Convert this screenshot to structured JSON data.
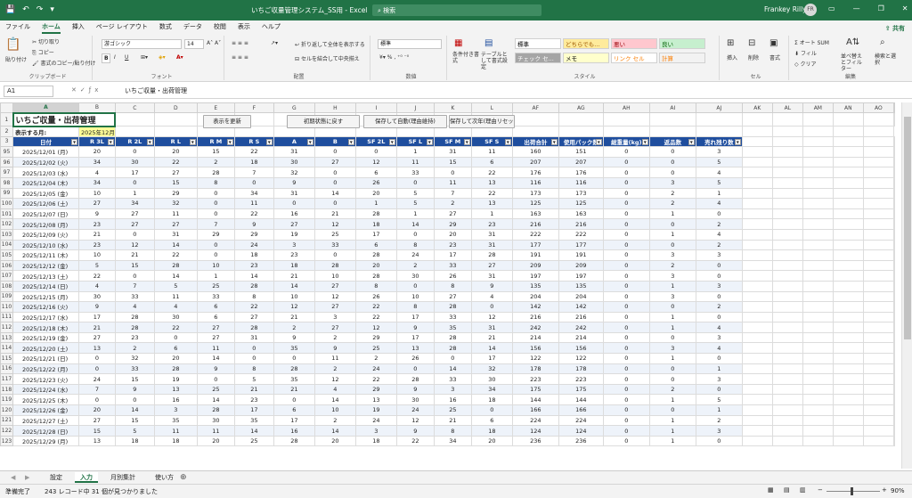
{
  "window": {
    "title": "いちご収量管理システム_SS用 - Excel",
    "search": "検索",
    "user": "Frankey Rilly",
    "avatar": "FR",
    "qat": [
      "💾",
      "↶",
      "↷",
      "▾"
    ],
    "controls": [
      "▭",
      "—",
      "❐",
      "✕"
    ]
  },
  "tabs": [
    {
      "label": "ファイル"
    },
    {
      "label": "ホーム",
      "active": true
    },
    {
      "label": "挿入"
    },
    {
      "label": "ページ レイアウト"
    },
    {
      "label": "数式"
    },
    {
      "label": "データ"
    },
    {
      "label": "校閲"
    },
    {
      "label": "表示"
    },
    {
      "label": "ヘルプ"
    }
  ],
  "share_label": "共有",
  "ribbon": {
    "clipboard": {
      "label": "クリップボード",
      "paste": "貼り付け",
      "cut": "切り取り",
      "copy": "コピー",
      "format_painter": "書式のコピー/貼り付け"
    },
    "font": {
      "label": "フォント",
      "name": "游ゴシック",
      "size": "14",
      "bold": "B",
      "italic": "I",
      "underline": "U"
    },
    "alignment": {
      "label": "配置",
      "wrap": "折り返して全体を表示する",
      "merge": "セルを結合して中央揃え"
    },
    "number": {
      "label": "数値",
      "format": "標準"
    },
    "styles": {
      "label": "スタイル",
      "conditional": "条件付き書式",
      "table": "テーブルとして書式設定",
      "cells": [
        {
          "text": "標準",
          "bg": "#ffffff",
          "color": "#000000"
        },
        {
          "text": "どちらでも...",
          "bg": "#ffeb9c",
          "color": "#9c5700"
        },
        {
          "text": "悪い",
          "bg": "#ffc7ce",
          "color": "#9c0006"
        },
        {
          "text": "良い",
          "bg": "#c6efce",
          "color": "#006100"
        },
        {
          "text": "チェック セ...",
          "bg": "#a5a5a5",
          "color": "#ffffff"
        },
        {
          "text": "メモ",
          "bg": "#ffffcc",
          "color": "#000000"
        },
        {
          "text": "リンク セル",
          "bg": "#ffffff",
          "color": "#fa7d00"
        },
        {
          "text": "計算",
          "bg": "#f2f2f2",
          "color": "#fa7d00"
        }
      ]
    },
    "cells_group": {
      "label": "セル",
      "insert": "挿入",
      "delete": "削除",
      "format": "書式"
    },
    "editing": {
      "label": "編集",
      "autosum": "オート SUM",
      "fill": "フィル",
      "clear": "クリア",
      "sort": "並べ替えとフィルター",
      "find": "検索と選択"
    }
  },
  "formula_bar": {
    "name_box": "A1",
    "content": "いちご収量・出荷管理"
  },
  "sheet": {
    "columns": [
      "A",
      "B",
      "C",
      "D",
      "E",
      "F",
      "G",
      "H",
      "I",
      "J",
      "K",
      "L",
      "AF",
      "AG",
      "AH",
      "AI",
      "AJ",
      "AK",
      "AL",
      "AM",
      "AN",
      "AO"
    ],
    "title": "いちご収量・出荷管理",
    "display_month_label": "表示する月:",
    "display_month_value": "2025年12月",
    "buttons": [
      "表示を更新",
      "初期状態に戻す",
      "保存して自動(理由維持)",
      "保存して次年(理由リセット)"
    ],
    "headers": [
      "日付",
      "R 3L",
      "R 2L",
      "R L",
      "R M",
      "R S",
      "A",
      "B",
      "SF 2L",
      "SF L",
      "SF M",
      "SF S",
      "出荷合計",
      "使用パック数",
      "総重量(kg)",
      "返品数",
      "売れ残り数"
    ],
    "rows": [
      [
        "95",
        "2025/12/01 (月)",
        "20",
        "0",
        "20",
        "15",
        "22",
        "31",
        "0",
        "0",
        "1",
        "31",
        "11",
        "160",
        "151",
        "0",
        "0",
        "3"
      ],
      [
        "96",
        "2025/12/02 (火)",
        "34",
        "30",
        "22",
        "2",
        "18",
        "30",
        "27",
        "12",
        "11",
        "15",
        "6",
        "207",
        "207",
        "0",
        "0",
        "5"
      ],
      [
        "97",
        "2025/12/03 (水)",
        "4",
        "17",
        "27",
        "28",
        "7",
        "32",
        "0",
        "6",
        "33",
        "0",
        "22",
        "176",
        "176",
        "0",
        "0",
        "4"
      ],
      [
        "98",
        "2025/12/04 (木)",
        "34",
        "0",
        "15",
        "8",
        "0",
        "9",
        "0",
        "26",
        "0",
        "11",
        "13",
        "116",
        "116",
        "0",
        "3",
        "5"
      ],
      [
        "99",
        "2025/12/05 (金)",
        "10",
        "1",
        "29",
        "0",
        "34",
        "31",
        "14",
        "20",
        "5",
        "7",
        "22",
        "173",
        "173",
        "0",
        "2",
        "1"
      ],
      [
        "100",
        "2025/12/06 (土)",
        "27",
        "34",
        "32",
        "0",
        "11",
        "0",
        "0",
        "1",
        "5",
        "2",
        "13",
        "125",
        "125",
        "0",
        "2",
        "4"
      ],
      [
        "101",
        "2025/12/07 (日)",
        "9",
        "27",
        "11",
        "0",
        "22",
        "16",
        "21",
        "28",
        "1",
        "27",
        "1",
        "163",
        "163",
        "0",
        "1",
        "0"
      ],
      [
        "102",
        "2025/12/08 (月)",
        "23",
        "27",
        "27",
        "7",
        "9",
        "27",
        "12",
        "18",
        "14",
        "29",
        "23",
        "216",
        "216",
        "0",
        "0",
        "2"
      ],
      [
        "103",
        "2025/12/09 (火)",
        "21",
        "0",
        "31",
        "29",
        "29",
        "19",
        "25",
        "17",
        "0",
        "20",
        "31",
        "222",
        "222",
        "0",
        "1",
        "4"
      ],
      [
        "104",
        "2025/12/10 (水)",
        "23",
        "12",
        "14",
        "0",
        "24",
        "3",
        "33",
        "6",
        "8",
        "23",
        "31",
        "177",
        "177",
        "0",
        "0",
        "2"
      ],
      [
        "105",
        "2025/12/11 (木)",
        "10",
        "21",
        "22",
        "0",
        "18",
        "23",
        "0",
        "28",
        "24",
        "17",
        "28",
        "191",
        "191",
        "0",
        "3",
        "3"
      ],
      [
        "106",
        "2025/12/12 (金)",
        "5",
        "15",
        "28",
        "10",
        "23",
        "18",
        "28",
        "20",
        "2",
        "33",
        "27",
        "209",
        "209",
        "0",
        "2",
        "0"
      ],
      [
        "107",
        "2025/12/13 (土)",
        "22",
        "0",
        "14",
        "1",
        "14",
        "21",
        "10",
        "28",
        "30",
        "26",
        "31",
        "197",
        "197",
        "0",
        "3",
        "0"
      ],
      [
        "108",
        "2025/12/14 (日)",
        "4",
        "7",
        "5",
        "25",
        "28",
        "14",
        "27",
        "8",
        "0",
        "8",
        "9",
        "135",
        "135",
        "0",
        "1",
        "3"
      ],
      [
        "109",
        "2025/12/15 (月)",
        "30",
        "33",
        "11",
        "33",
        "8",
        "10",
        "12",
        "26",
        "10",
        "27",
        "4",
        "204",
        "204",
        "0",
        "3",
        "0"
      ],
      [
        "110",
        "2025/12/16 (火)",
        "9",
        "4",
        "4",
        "6",
        "22",
        "12",
        "27",
        "22",
        "8",
        "28",
        "0",
        "142",
        "142",
        "0",
        "0",
        "2"
      ],
      [
        "111",
        "2025/12/17 (水)",
        "17",
        "28",
        "30",
        "6",
        "27",
        "21",
        "3",
        "22",
        "17",
        "33",
        "12",
        "216",
        "216",
        "0",
        "1",
        "0"
      ],
      [
        "112",
        "2025/12/18 (木)",
        "21",
        "28",
        "22",
        "27",
        "28",
        "2",
        "27",
        "12",
        "9",
        "35",
        "31",
        "242",
        "242",
        "0",
        "1",
        "4"
      ],
      [
        "113",
        "2025/12/19 (金)",
        "27",
        "23",
        "0",
        "27",
        "31",
        "9",
        "2",
        "29",
        "17",
        "28",
        "21",
        "214",
        "214",
        "0",
        "0",
        "3"
      ],
      [
        "114",
        "2025/12/20 (土)",
        "13",
        "2",
        "6",
        "11",
        "0",
        "35",
        "9",
        "25",
        "13",
        "28",
        "14",
        "156",
        "156",
        "0",
        "3",
        "4"
      ],
      [
        "115",
        "2025/12/21 (日)",
        "0",
        "32",
        "20",
        "14",
        "0",
        "0",
        "11",
        "2",
        "26",
        "0",
        "17",
        "122",
        "122",
        "0",
        "1",
        "0"
      ],
      [
        "116",
        "2025/12/22 (月)",
        "0",
        "33",
        "28",
        "9",
        "8",
        "28",
        "2",
        "24",
        "0",
        "14",
        "32",
        "178",
        "178",
        "0",
        "0",
        "1"
      ],
      [
        "117",
        "2025/12/23 (火)",
        "24",
        "15",
        "19",
        "0",
        "5",
        "35",
        "12",
        "22",
        "28",
        "33",
        "30",
        "223",
        "223",
        "0",
        "0",
        "3"
      ],
      [
        "118",
        "2025/12/24 (水)",
        "7",
        "9",
        "13",
        "25",
        "21",
        "21",
        "4",
        "29",
        "9",
        "3",
        "34",
        "175",
        "175",
        "0",
        "2",
        "0"
      ],
      [
        "119",
        "2025/12/25 (木)",
        "0",
        "0",
        "16",
        "14",
        "23",
        "0",
        "14",
        "13",
        "30",
        "16",
        "18",
        "144",
        "144",
        "0",
        "1",
        "5"
      ],
      [
        "120",
        "2025/12/26 (金)",
        "20",
        "14",
        "3",
        "28",
        "17",
        "6",
        "10",
        "19",
        "24",
        "25",
        "0",
        "166",
        "166",
        "0",
        "0",
        "1"
      ],
      [
        "121",
        "2025/12/27 (土)",
        "27",
        "15",
        "35",
        "30",
        "35",
        "17",
        "2",
        "24",
        "12",
        "21",
        "6",
        "224",
        "224",
        "0",
        "1",
        "2"
      ],
      [
        "122",
        "2025/12/28 (日)",
        "15",
        "5",
        "11",
        "11",
        "14",
        "16",
        "14",
        "3",
        "9",
        "8",
        "18",
        "124",
        "124",
        "0",
        "1",
        "3"
      ],
      [
        "123",
        "2025/12/29 (月)",
        "13",
        "18",
        "18",
        "20",
        "25",
        "28",
        "20",
        "18",
        "22",
        "34",
        "20",
        "236",
        "236",
        "0",
        "1",
        "0"
      ]
    ]
  },
  "sheet_tabs": [
    {
      "label": "設定"
    },
    {
      "label": "入力",
      "active": true
    },
    {
      "label": "月別集計"
    },
    {
      "label": "使い方"
    }
  ],
  "status": {
    "ready": "準備完了",
    "records": "243 レコード中 31 個が見つかりました",
    "zoom": "90%"
  }
}
